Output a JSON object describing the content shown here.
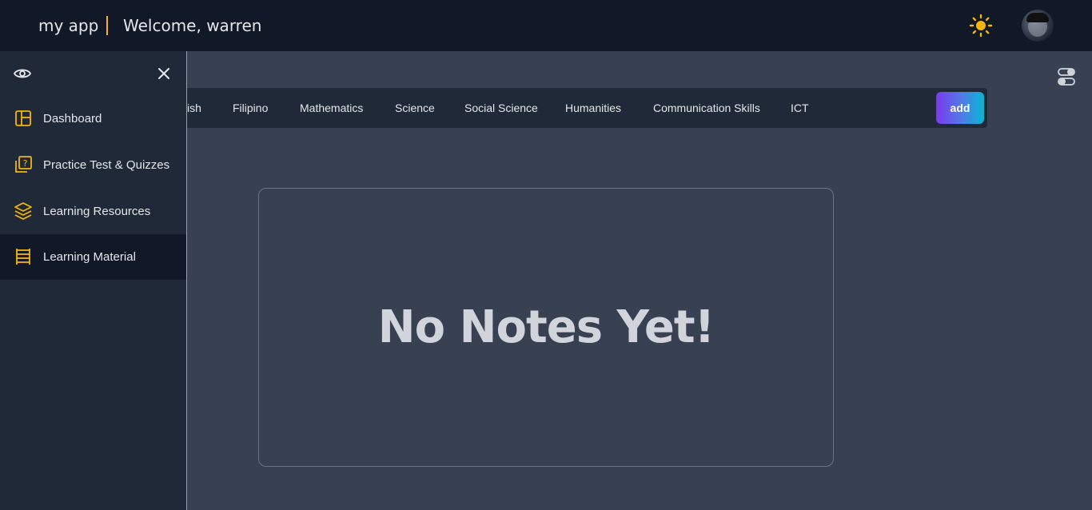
{
  "header": {
    "app_name": "my app",
    "welcome": "Welcome, warren",
    "theme_icon": "sun-icon",
    "avatar_icon": "user-avatar"
  },
  "sidebar": {
    "items": [
      {
        "label": "Dashboard",
        "icon": "layout-icon"
      },
      {
        "label": "Practice Test & Quizzes",
        "icon": "quiz-icon"
      },
      {
        "label": "Learning Resources",
        "icon": "layers-icon"
      },
      {
        "label": "Learning Material",
        "icon": "ladder-icon",
        "active": true
      }
    ]
  },
  "subjects": {
    "tabs": [
      "ish",
      "Filipino",
      "Mathematics",
      "Science",
      "Social Science",
      "Humanities",
      "Communication Skills",
      "ICT"
    ],
    "add_label": "add"
  },
  "notes": {
    "empty_message": "No Notes Yet!"
  },
  "colors": {
    "accent": "#f5b50a",
    "topbar": "#111827",
    "sidebar": "#1f2937",
    "content": "#374151"
  }
}
